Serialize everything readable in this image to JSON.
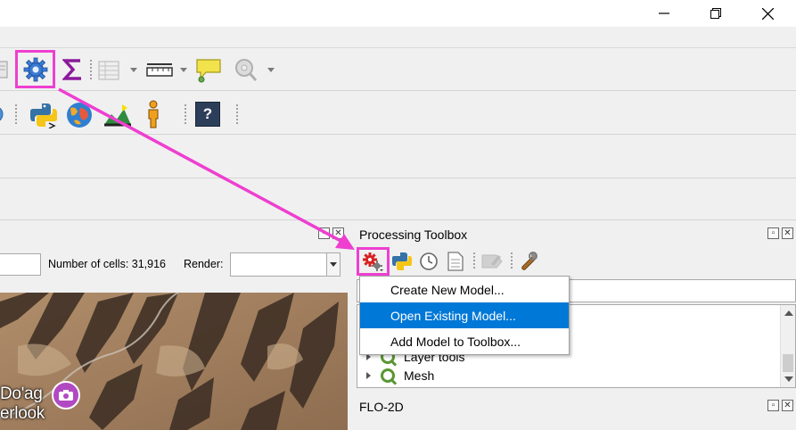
{
  "window": {
    "minimize_icon": "minimize-icon",
    "maximize_icon": "restore-icon",
    "close_icon": "close-icon"
  },
  "toolbar1": {
    "icons": [
      "processing-gear-icon",
      "sigma-statistics-icon",
      "attribute-table-icon",
      "measure-ruler-icon",
      "annotation-icon",
      "identify-icon"
    ]
  },
  "toolbar2": {
    "icons": [
      "python-console-icon",
      "globe-icon",
      "profile-icon",
      "person-icon",
      "help-icon"
    ],
    "help_label": "?"
  },
  "map_panel": {
    "cells_label": "Number of cells: 31,916",
    "render_label": "Render:",
    "render_value": "",
    "map_labels": [
      "Do'ag",
      "erlook"
    ]
  },
  "processing_toolbox": {
    "title": "Processing Toolbox",
    "tree": [
      {
        "label": "Layer tools"
      },
      {
        "label": "Mesh"
      }
    ]
  },
  "model_menu": {
    "items": [
      {
        "label": "Create New Model...",
        "active": false
      },
      {
        "label": "Open Existing Model...",
        "active": true
      },
      {
        "label": "Add Model to Toolbox...",
        "active": false
      }
    ]
  },
  "flo2d": {
    "title": "FLO-2D"
  },
  "colors": {
    "highlight": "#ee3fd0",
    "menu_selection": "#0078d7",
    "qgis_green": "#589632",
    "sigma_purple": "#8b1a9a"
  }
}
